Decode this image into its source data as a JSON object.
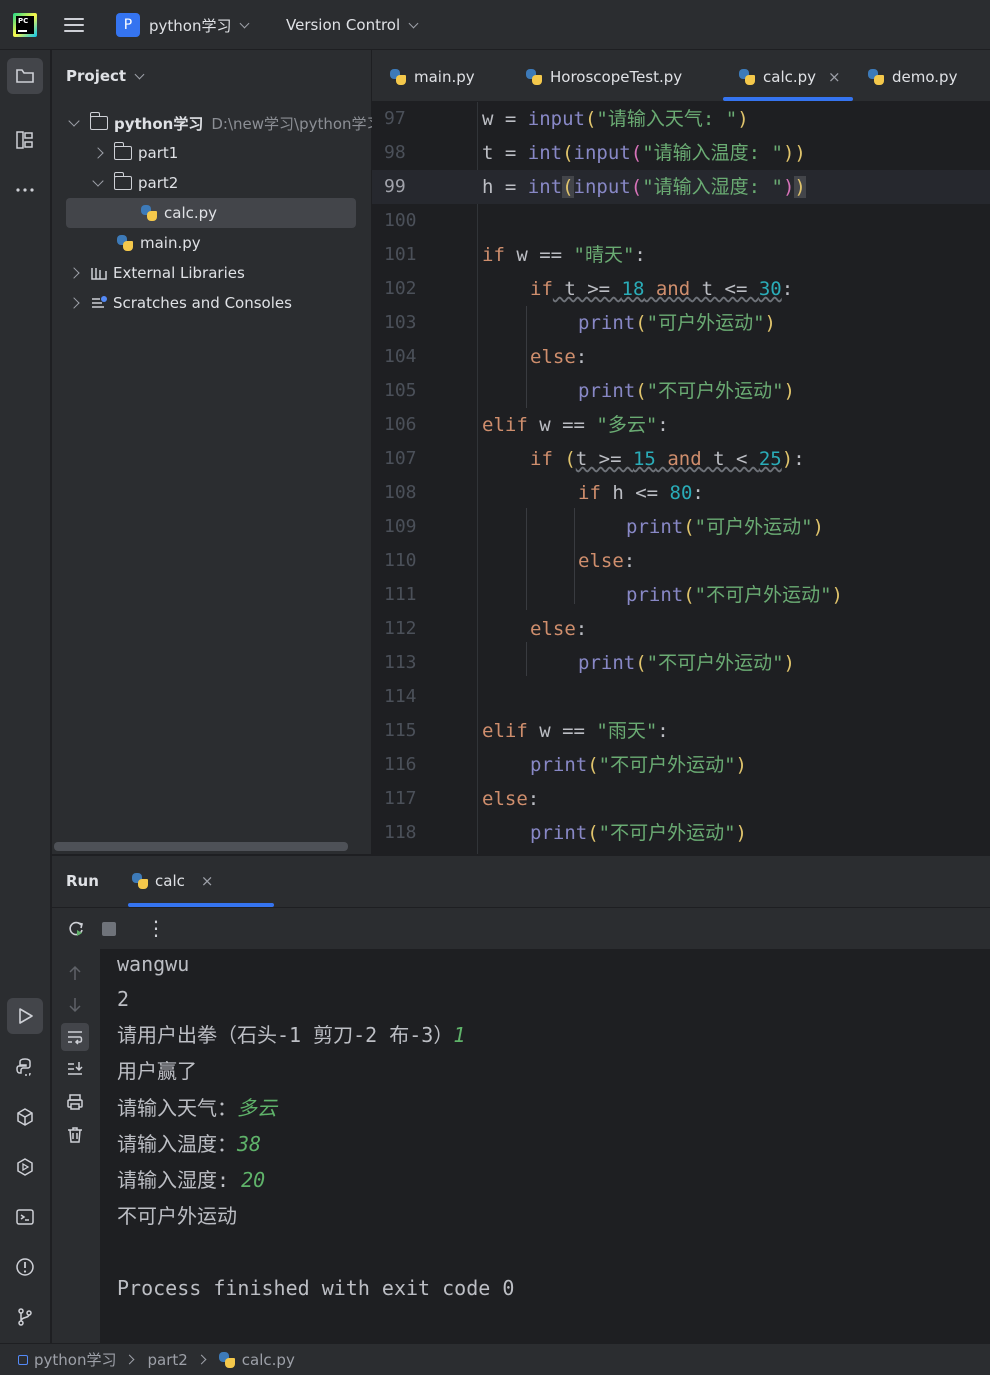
{
  "titlebar": {
    "project_badge": "P",
    "project_name": "python学习",
    "vcs_label": "Version Control"
  },
  "project_panel": {
    "header": "Project",
    "tree": [
      {
        "label": "python学习",
        "path": "D:\\new学习\\python学习"
      },
      {
        "label": "part1"
      },
      {
        "label": "part2"
      },
      {
        "label": "calc.py"
      },
      {
        "label": "main.py"
      },
      {
        "label": "External Libraries"
      },
      {
        "label": "Scratches and Consoles"
      }
    ]
  },
  "editor": {
    "tabs": [
      {
        "label": "main.py"
      },
      {
        "label": "HoroscopeTest.py"
      },
      {
        "label": "calc.py",
        "active": true
      },
      {
        "label": "demo.py"
      }
    ],
    "close_glyph": "×",
    "current_line": 99,
    "lines": [
      {
        "n": "97"
      },
      {
        "n": "98"
      },
      {
        "n": "99"
      },
      {
        "n": "100"
      },
      {
        "n": "101"
      },
      {
        "n": "102"
      },
      {
        "n": "103"
      },
      {
        "n": "104"
      },
      {
        "n": "105"
      },
      {
        "n": "106"
      },
      {
        "n": "107"
      },
      {
        "n": "108"
      },
      {
        "n": "109"
      },
      {
        "n": "110"
      },
      {
        "n": "111"
      },
      {
        "n": "112"
      },
      {
        "n": "113"
      },
      {
        "n": "114"
      },
      {
        "n": "115"
      },
      {
        "n": "116"
      },
      {
        "n": "117"
      },
      {
        "n": "118"
      }
    ],
    "code": {
      "l97": {
        "a": "w = ",
        "b": "input",
        "c": "(",
        "d": "\"请输入天气: \"",
        "e": ")"
      },
      "l98": {
        "a": "t = ",
        "b": "int",
        "c": "(",
        "d": "input",
        "e": "(",
        "f": "\"请输入温度: \"",
        "g": "))"
      },
      "l99": {
        "a": "h = ",
        "b": "int",
        "c": "(",
        "d": "input",
        "e": "(",
        "f": "\"请输入湿度: \"",
        "g": ")",
        "h": ")"
      },
      "l101": {
        "a": "if",
        "b": " w == ",
        "c": "\"晴天\"",
        "d": ":"
      },
      "l102": {
        "a": "if",
        "b": " t >= ",
        "c": "18",
        "d": " and",
        "e": " t <= ",
        "f": "30",
        "g": ":"
      },
      "l103": {
        "a": "print",
        "b": "(",
        "c": "\"可户外运动\"",
        "d": ")"
      },
      "l104": {
        "a": "else",
        "b": ":"
      },
      "l105": {
        "a": "print",
        "b": "(",
        "c": "\"不可户外运动\"",
        "d": ")"
      },
      "l106": {
        "a": "elif",
        "b": " w == ",
        "c": "\"多云\"",
        "d": ":"
      },
      "l107": {
        "a": "if",
        "b": " (",
        "c": "t >= ",
        "d": "15",
        "e": " and",
        "f": " t < ",
        "g": "25",
        "h": ")",
        "i": ":"
      },
      "l108": {
        "a": "if",
        "b": " h <= ",
        "c": "80",
        "d": ":"
      },
      "l109": {
        "a": "print",
        "b": "(",
        "c": "\"可户外运动\"",
        "d": ")"
      },
      "l110": {
        "a": "else",
        "b": ":"
      },
      "l111": {
        "a": "print",
        "b": "(",
        "c": "\"不可户外运动\"",
        "d": ")"
      },
      "l112": {
        "a": "else",
        "b": ":"
      },
      "l113": {
        "a": "print",
        "b": "(",
        "c": "\"不可户外运动\"",
        "d": ")"
      },
      "l115": {
        "a": "elif",
        "b": " w == ",
        "c": "\"雨天\"",
        "d": ":"
      },
      "l116": {
        "a": "print",
        "b": "(",
        "c": "\"不可户外运动\"",
        "d": ")"
      },
      "l117": {
        "a": "else",
        "b": ":"
      },
      "l118": {
        "a": "print",
        "b": "(",
        "c": "\"不可户外运动\"",
        "d": ")"
      }
    }
  },
  "run": {
    "title": "Run",
    "tab_label": "calc",
    "close_glyph": "×",
    "kebab": "⋮",
    "console": [
      {
        "text": "wangwu"
      },
      {
        "text": "2"
      },
      {
        "text": "请用户出拳（石头-1 剪刀-2 布-3）",
        "input": "1"
      },
      {
        "text": "用户赢了"
      },
      {
        "text": "请输入天气：",
        "input": "多云"
      },
      {
        "text": "请输入温度：",
        "input": "38"
      },
      {
        "text": "请输入湿度: ",
        "input": "20"
      },
      {
        "text": "不可户外运动"
      },
      {
        "text": ""
      },
      {
        "text": "Process finished with exit code 0"
      }
    ]
  },
  "statusbar": {
    "crumbs": [
      "python学习",
      "part2",
      "calc.py"
    ]
  },
  "colors": {
    "accent": "#3574f0",
    "keyword": "#cf8e6d",
    "string": "#6aab73",
    "number": "#2aacb8",
    "builtin": "#8888c6",
    "function": "#56a8f5",
    "user_input": "#5fb36a"
  }
}
